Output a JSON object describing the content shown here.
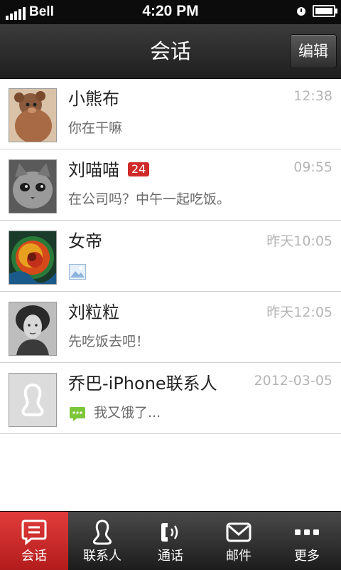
{
  "status_bar": {
    "carrier": "Bell",
    "time": "4:20 PM",
    "signal_bars": 5
  },
  "header": {
    "title": "会话",
    "edit_label": "编辑"
  },
  "conversations": [
    {
      "name": "小熊布",
      "time": "12:38",
      "message": "你在干嘛"
    },
    {
      "name": "刘喵喵",
      "badge": "24",
      "time": "09:55",
      "message": "在公司吗？中午一起吃饭。"
    },
    {
      "name": "女帝",
      "time": "昨天10:05",
      "message_icon": "image-icon"
    },
    {
      "name": "刘粒粒",
      "time": "昨天12:05",
      "message": "先吃饭去吧！"
    },
    {
      "name": "乔巴-iPhone联系人",
      "time": "2012-03-05",
      "message": "我又饿了...",
      "message_icon": "chat-bubble-icon"
    }
  ],
  "tabs": [
    {
      "label": "会话",
      "icon": "chat-icon",
      "active": true
    },
    {
      "label": "联系人",
      "icon": "contact-icon",
      "active": false
    },
    {
      "label": "通话",
      "icon": "phone-icon",
      "active": false
    },
    {
      "label": "邮件",
      "icon": "mail-icon",
      "active": false
    },
    {
      "label": "更多",
      "icon": "more-icon",
      "active": false
    }
  ],
  "colors": {
    "accent": "#cf2a2a",
    "tab_active": "#c92828",
    "chat_icon_green": "#7cc63a"
  }
}
